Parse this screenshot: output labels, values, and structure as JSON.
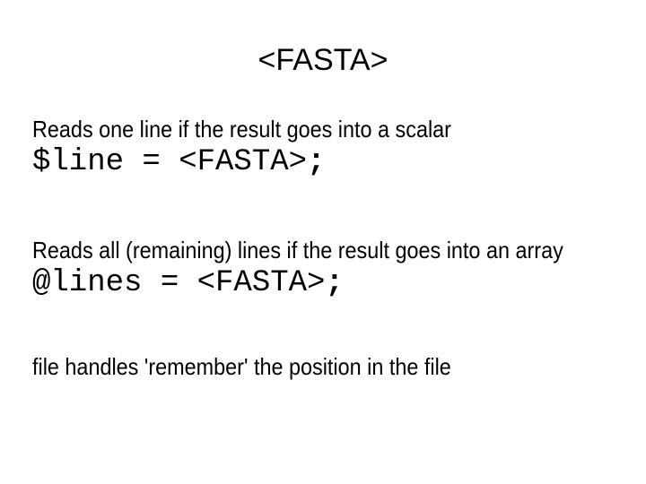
{
  "slide": {
    "title": "<FASTA>",
    "background_color": "#ffffff",
    "text_color": "#000000",
    "blocks": [
      {
        "kind": "text",
        "name": "scalar-read-description",
        "text": "Reads one line if the result goes into a scalar"
      },
      {
        "kind": "code",
        "name": "scalar-read-code",
        "code": "$line = <FASTA>",
        "terminator": ";"
      },
      {
        "kind": "text",
        "name": "array-read-description",
        "text": "Reads all (remaining) lines if the result goes into an array"
      },
      {
        "kind": "code",
        "name": "array-read-code",
        "code": "@lines = <FASTA>",
        "terminator": ";"
      },
      {
        "kind": "text",
        "name": "filehandle-position-note",
        "text": "file handles 'remember' the position in the file"
      }
    ]
  }
}
